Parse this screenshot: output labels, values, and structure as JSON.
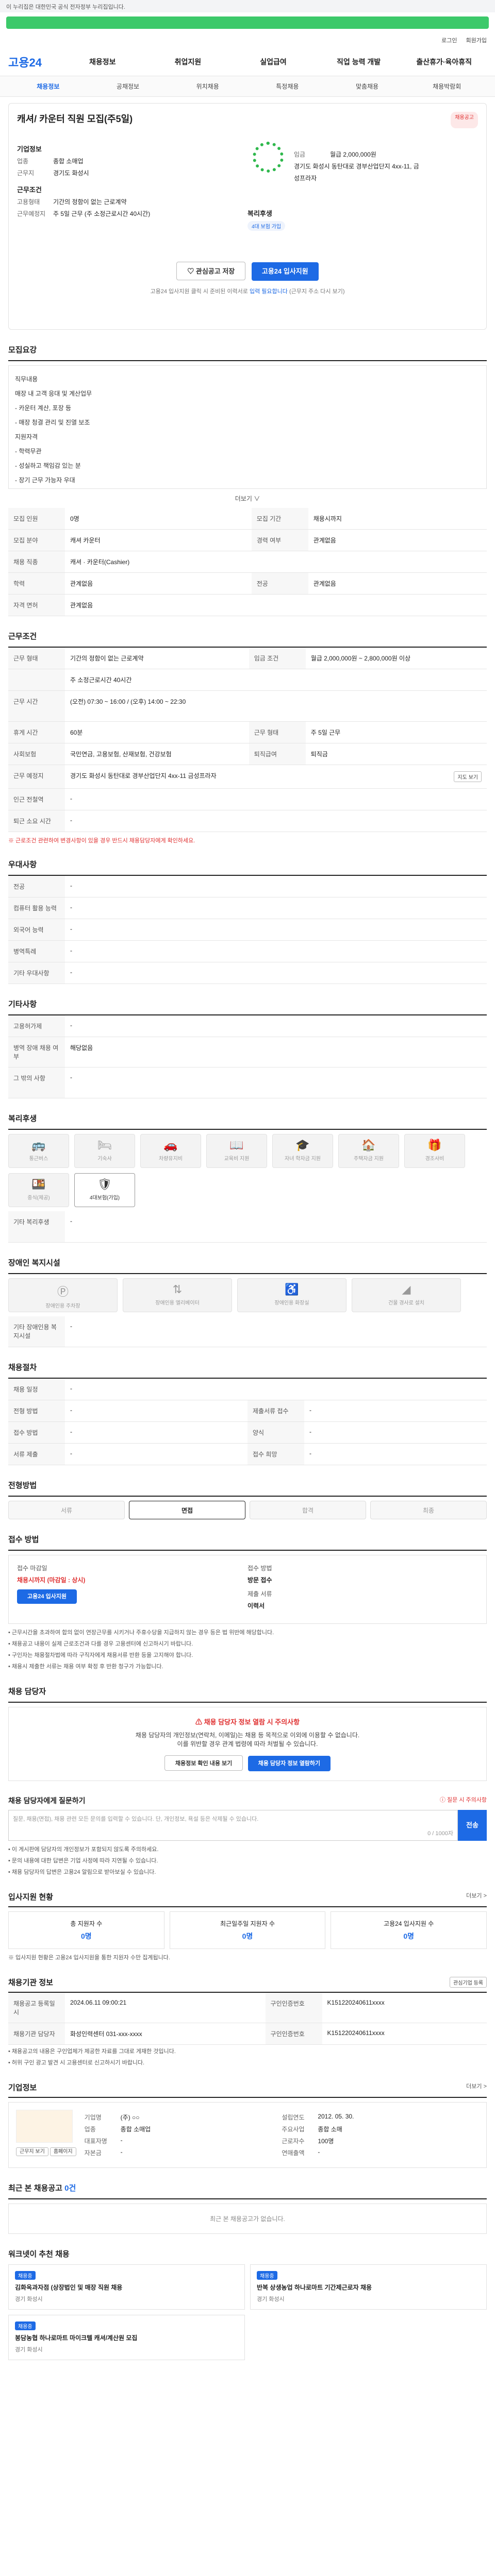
{
  "gov_bar": "이 누리집은 대한민국 공식 전자정부 누리집입니다.",
  "util": [
    "로그인",
    "회원가입"
  ],
  "logo": "고용24",
  "gnb": [
    "채용정보",
    "취업지원",
    "실업급여",
    "직업 능력 개발",
    "출산휴가·육아휴직"
  ],
  "subnav": [
    "채용정보",
    "공채정보",
    "위치채용",
    "특정채용",
    "맞춤채용",
    "채용박람회"
  ],
  "summary": {
    "title": "캐셔/ 카운터 직원 모집(주5일)",
    "company_label": "기업정보",
    "badge": "채용공고",
    "rows": [
      {
        "k": "업종",
        "v": "종합 소매업"
      },
      {
        "k": "근무지",
        "v": "경기도 화성시"
      }
    ],
    "work_label": "근무조건",
    "work_rows": [
      {
        "k": "고용형태",
        "v": "기간의 정함이 없는 근로계약"
      },
      {
        "k": "근무예정지",
        "v": "주 5일 근무 (주 소정근로시간 40시간)"
      }
    ],
    "welfare_label": "복리후생",
    "welfare_value": "4대 보험 가입",
    "pay_label": "임금",
    "pay_value": "월급 2,000,000원",
    "addr": "경기도 화성시 동탄대로 경부산업단지 4xx-11, 금",
    "addr2": "성프라자",
    "save_btn": "관심공고 저장",
    "apply_btn": "고용24 입사지원",
    "note1": "고용24 입사지원 클릭 시 준비된 이력서로",
    "note_em": "입력 필요합니다",
    "note2": "(근무지 주소 다시 보기)"
  },
  "recruit": {
    "title": "모집요강",
    "body": [
      "직무내용",
      "매장 내 고객 응대 및 계산업무",
      "- 카운터 계산, 포장 등",
      "- 매장 청결 관리 및 진열 보조",
      "지원자격",
      "- 학력무관",
      "- 성실하고 책임감 있는 분",
      "- 장기 근무 가능자 우대"
    ],
    "more": "더보기 ∨",
    "table": [
      {
        "k": "모집 인원",
        "v": "0명",
        "k2": "모집 기간",
        "v2": "채용시까지"
      },
      {
        "k": "모집 분야",
        "v": "캐셔 카운터",
        "k2": "경력 여부",
        "v2": "관계없음"
      },
      {
        "k": "채용 직종",
        "v": "캐셔 · 카운터(Cashier)",
        "k2": "",
        "v2": ""
      },
      {
        "k": "학력",
        "v": "관계없음",
        "k2": "전공",
        "v2": "관계없음"
      },
      {
        "k": "자격 면허",
        "v": "관계없음",
        "k2": "",
        "v2": ""
      }
    ]
  },
  "work": {
    "title": "근무조건",
    "table": [
      {
        "k": "근무 형태",
        "v": "기간의 정함이 없는 근로계약",
        "k2": "임금 조건",
        "v2": "월급 2,000,000원 ~ 2,800,000원 이상"
      },
      {
        "k": "",
        "v": "주 소정근로시간 40시간",
        "k2": "",
        "v2": ""
      },
      {
        "k": "근무 시간",
        "v": "(오전) 07:30 ~ 16:00 / (오후) 14:00 ~ 22:30",
        "k2": "",
        "v2": ""
      },
      {
        "k": "휴게 시간",
        "v": "60분",
        "k2": "근무 형태",
        "v2": "주 5일 근무"
      },
      {
        "k": "사회보험",
        "v": "국민연금, 고용보험, 산재보험, 건강보험",
        "k2": "퇴직급여",
        "v2": "퇴직금"
      },
      {
        "k": "근무 예정지",
        "v": "경기도 화성시 동탄대로 경부산업단지 4xx-11 금성프라자",
        "k2": "",
        "v2": ""
      },
      {
        "k": "인근 전철역",
        "v": "-",
        "k2": "",
        "v2": ""
      },
      {
        "k": "퇴근 소요 시간",
        "v": "-",
        "k2": "",
        "v2": ""
      }
    ],
    "map_btn": "지도 보기",
    "red_note": "※ 근로조건 관련하여 변경사항이 있을 경우 반드시 채용담당자에게 확인하세요."
  },
  "preference": {
    "title": "우대사항",
    "table": [
      {
        "k": "전공",
        "v": "-"
      },
      {
        "k": "컴퓨터 활용 능력",
        "v": "-"
      },
      {
        "k": "외국어 능력",
        "v": "-"
      },
      {
        "k": "병역특례",
        "v": "-"
      },
      {
        "k": "기타 우대사항",
        "v": "-"
      }
    ]
  },
  "etc": {
    "title": "기타사항",
    "table": [
      {
        "k": "고용허가제",
        "v": "-"
      },
      {
        "k": "병역 장애 채용 여부",
        "v": "해당없음"
      },
      {
        "k": "그 밖의 사항",
        "v": "-"
      }
    ]
  },
  "welfare": {
    "title": "복리후생",
    "tiles": [
      "통근버스",
      "기숙사",
      "차량유지비",
      "교육비 지원",
      "자녀 학자금 지원",
      "주택자금 지원",
      "경조사비",
      "중식(제공)",
      "4대보험(가입)"
    ],
    "extra_k": "기타 복리후생",
    "extra_v": "-"
  },
  "disabled": {
    "title": "장애인 복지시설",
    "tiles": [
      "장애인용 주차장",
      "장애인용 엘리베이터",
      "장애인용 화장실",
      "건물 경사로 설치"
    ],
    "extra_k": "기타 장애인용 복지시설",
    "extra_v": "-"
  },
  "hire": {
    "title": "채용절차",
    "table": [
      {
        "k": "채용 일정",
        "v": "-",
        "k2": "",
        "v2": ""
      },
      {
        "k": "전형 방법",
        "v": "-",
        "k2": "제출서류 접수",
        "v2": "-"
      },
      {
        "k": "접수 방법",
        "v": "-",
        "k2": "양식",
        "v2": "-"
      },
      {
        "k": "서류 제출",
        "v": "-",
        "k2": "접수 희망",
        "v2": "-"
      }
    ]
  },
  "process": {
    "title": "전형방법",
    "steps": [
      "서류",
      "면접",
      "합격",
      "최종"
    ]
  },
  "apply": {
    "title": "접수 방법",
    "col1_label": "접수 마감일",
    "col1_val": "채용시까지 (마감일 : 상시)",
    "col2_label": "접수 방법",
    "col2_val": "방문 접수",
    "col3_label": "제출 서류",
    "col3_val": "이력서",
    "apply_btn": "고용24 입사지원",
    "bullets": [
      "• 근무시간을 초과하여 합의 없이 연장근무를 시키거나 주휴수당을 지급하지 않는 경우 등은 법 위반에 해당합니다.",
      "• 채용공고 내용이 실제 근로조건과 다를 경우 고용센터에 신고하시기 바랍니다.",
      "• 구인자는 채용절차법에 따라 구직자에게 채용서류 반환 등을 고지해야 합니다.",
      "• 채용시 제출한 서류는 채용 여부 확정 후 반환 청구가 가능합니다."
    ]
  },
  "manager": {
    "title": "채용 담당자",
    "warn": "채용 담당자 정보 열람 시 주의사항",
    "desc1": "채용 담당자의 개인정보(연락처, 이메일)는 채용 등 목적으로 이외에 이용할 수 없습니다.",
    "desc2": "이를 위반할 경우 관계 법령에 따라 처벌될 수 있습니다.",
    "btn1": "채용정보 확인 내용 보기",
    "btn2": "채용 담당자 정보 열람하기"
  },
  "ask": {
    "title": "채용 담당자에게 질문하기",
    "hint": "ⓘ 질문 시 주의사항",
    "placeholder": "질문, 채용(면접), 채용 관련 모든 문의를 입력할 수 있습니다. 단, 개인정보, 욕설 등은 삭제될 수 있습니다.",
    "count": "0 / 1000자",
    "send": "전송",
    "notes": [
      "• 이 게시판에 담당자의 개인정보가 포함되지 않도록 주의하세요.",
      "• 문의 내용에 대한 답변은 기업 사정에 따라 지연될 수 있습니다.",
      "• 채용 담당자의 답변은 고용24 알림으로 받아보실 수 있습니다."
    ]
  },
  "stats": {
    "title": "입사지원 현황",
    "more": "더보기 >",
    "items": [
      {
        "label": "총 지원자 수",
        "num": "0명"
      },
      {
        "label": "최근일주일 지원자 수",
        "num": "0명"
      },
      {
        "label": "고용24 입사지원 수",
        "num": "0명"
      }
    ],
    "note": "※ 입사지원 현황은 고용24 입사지원을 통한 지원자 수만 집계됩니다."
  },
  "info": {
    "title": "채용기관 정보",
    "share_btn": "관심기업 등록",
    "table": [
      {
        "k": "채용공고 등록일시",
        "v": "2024.06.11 09:00:21",
        "k2": "구인인증번호",
        "v2": "K151220240611xxxx"
      },
      {
        "k": "채용기관 담당자",
        "v": "화성인력센터 031-xxx-xxxx",
        "k2": "구인인증번호",
        "v2": "K151220240611xxxx"
      }
    ],
    "notes": [
      "• 채용공고의 내용은 구인업체가 제공한 자료를 그대로 게재한 것입니다.",
      "• 허위 구인 광고 발견 시 고용센터로 신고하시기 바랍니다."
    ]
  },
  "company": {
    "title": "기업정보",
    "more": "더보기 >",
    "rows": [
      {
        "k": "기업명",
        "v": "(주) ○○",
        "k2": "설립연도",
        "v2": "2012. 05. 30."
      },
      {
        "k": "업종",
        "v": "종합 소매업",
        "k2": "주요사업",
        "v2": "종합 소매"
      },
      {
        "k": "대표자명",
        "v": "-",
        "k2": "근로자수",
        "v2": "100명"
      },
      {
        "k": "자본금",
        "v": "-",
        "k2": "연매출액",
        "v2": "-"
      }
    ],
    "btn1": "근무지 보기",
    "btn2": "홈페이지"
  },
  "related": {
    "title": "최근 본 채용공고",
    "count": "0건",
    "empty": "최근 본 채용공고가 없습니다."
  },
  "recommend": {
    "title": "워크넷이 추천 채용",
    "items": [
      {
        "tag": "채용중",
        "t": "김화옥과자점 (상장법인 및 매장 직원 채용",
        "d": "경기 화성시"
      },
      {
        "tag": "채용중",
        "t": "반복 상생농업 하나로마트 기간제근로자 채용",
        "d": "경기 화성시"
      },
      {
        "tag": "채용중",
        "t": "봉담농협 하나로마트 마이크텔 캐셔/계산원 모집",
        "d": "경기 화성시"
      },
      {
        "tag": "",
        "t": "",
        "d": ""
      }
    ]
  }
}
